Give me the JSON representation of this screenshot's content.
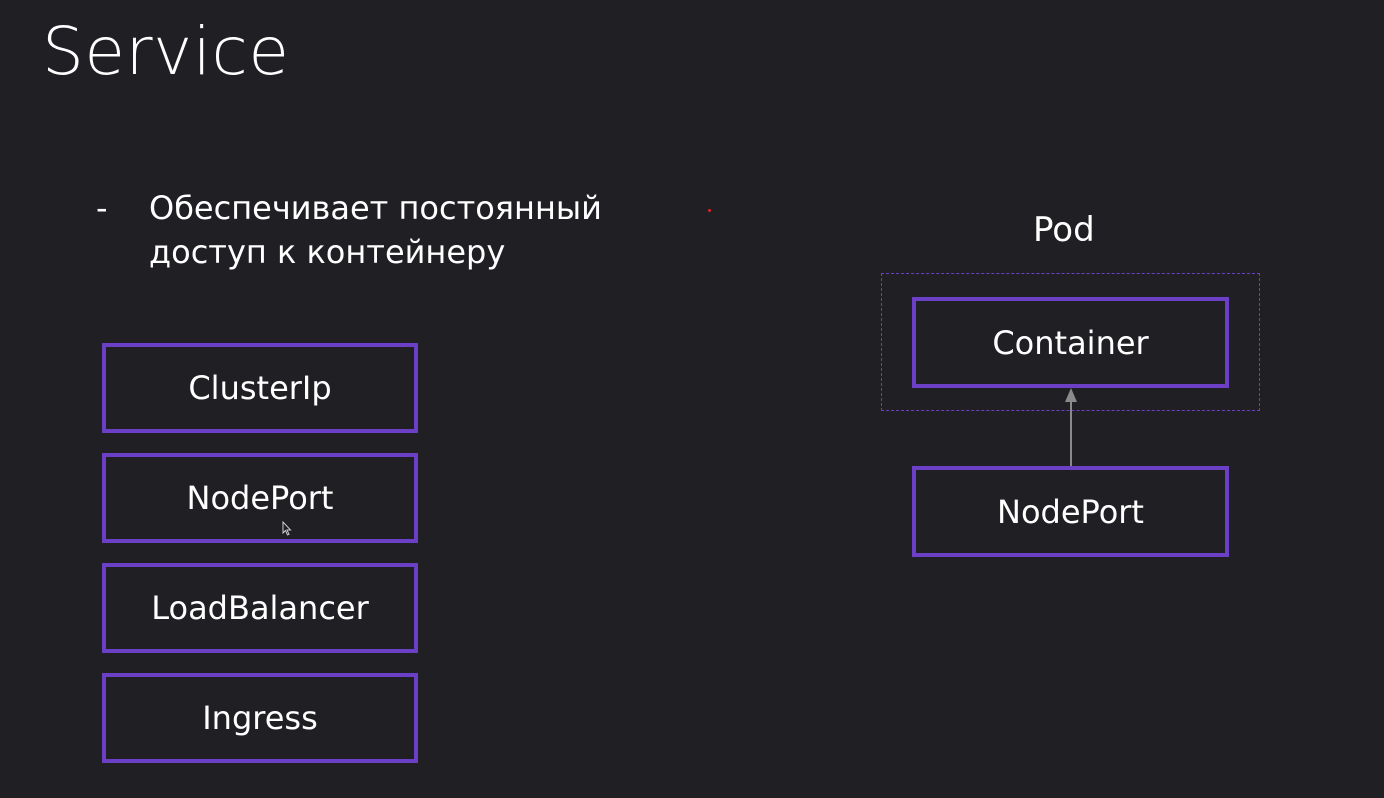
{
  "slide": {
    "title": "Service",
    "bullet_marker": "-",
    "bullet_text": "Обеспечивает постоянный доступ к контейнеру"
  },
  "service_types": [
    {
      "label": "ClusterIp"
    },
    {
      "label": "NodePort"
    },
    {
      "label": "LoadBalancer"
    },
    {
      "label": "Ingress"
    }
  ],
  "diagram": {
    "pod_label": "Pod",
    "container_label": "Container",
    "nodeport_label": "NodePort"
  },
  "colors": {
    "background": "#201f24",
    "box_border": "#6b3fc6",
    "text": "#ffffff",
    "arrow": "#8a8a8a"
  }
}
